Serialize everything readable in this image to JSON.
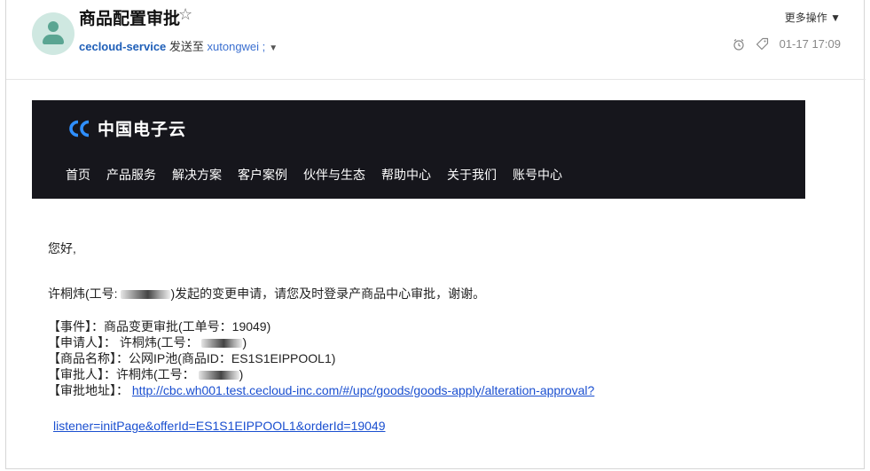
{
  "email": {
    "subject": "商品配置审批",
    "star_glyph": "☆",
    "sender": "cecloud-service",
    "sent_to": " 发送至 ",
    "recipient": "xutongwei",
    "recipient_sep": " ;",
    "caret": "▼",
    "more_actions": "更多操作 ▼",
    "datetime": "01-17 17:09"
  },
  "brand": {
    "name": "中国电子云",
    "nav": [
      "首页",
      "产品服务",
      "解决方案",
      "客户案例",
      "伙伴与生态",
      "帮助中心",
      "关于我们",
      "账号中心"
    ]
  },
  "body": {
    "greeting": "您好,",
    "intro_prefix": "许桐炜(工号:",
    "intro_suffix": ")发起的变更申请，请您及时登录产商品中心审批，谢谢。",
    "event": "【事件】：商品变更审批(工单号：19049)",
    "applicant_prefix": "【申请人】： 许桐炜(工号：",
    "applicant_suffix": ")",
    "product": "【商品名称】：公网IP池(商品ID：ES1S1EIPPOOL1)",
    "approver_prefix": "【审批人】：许桐炜(工号：",
    "approver_suffix": ")",
    "address_label": "【审批地址】：",
    "url_line1": "http://cbc.wh001.test.cecloud-inc.com/#/upc/goods/goods-apply/alteration-approval?",
    "url_line2": "listener=initPage&offerId=ES1S1EIPPOOL1&orderId=19049"
  },
  "colors": {
    "brand_bg": "#16161c",
    "logo_blue": "#2f8fff",
    "link": "#1a4fd0"
  }
}
